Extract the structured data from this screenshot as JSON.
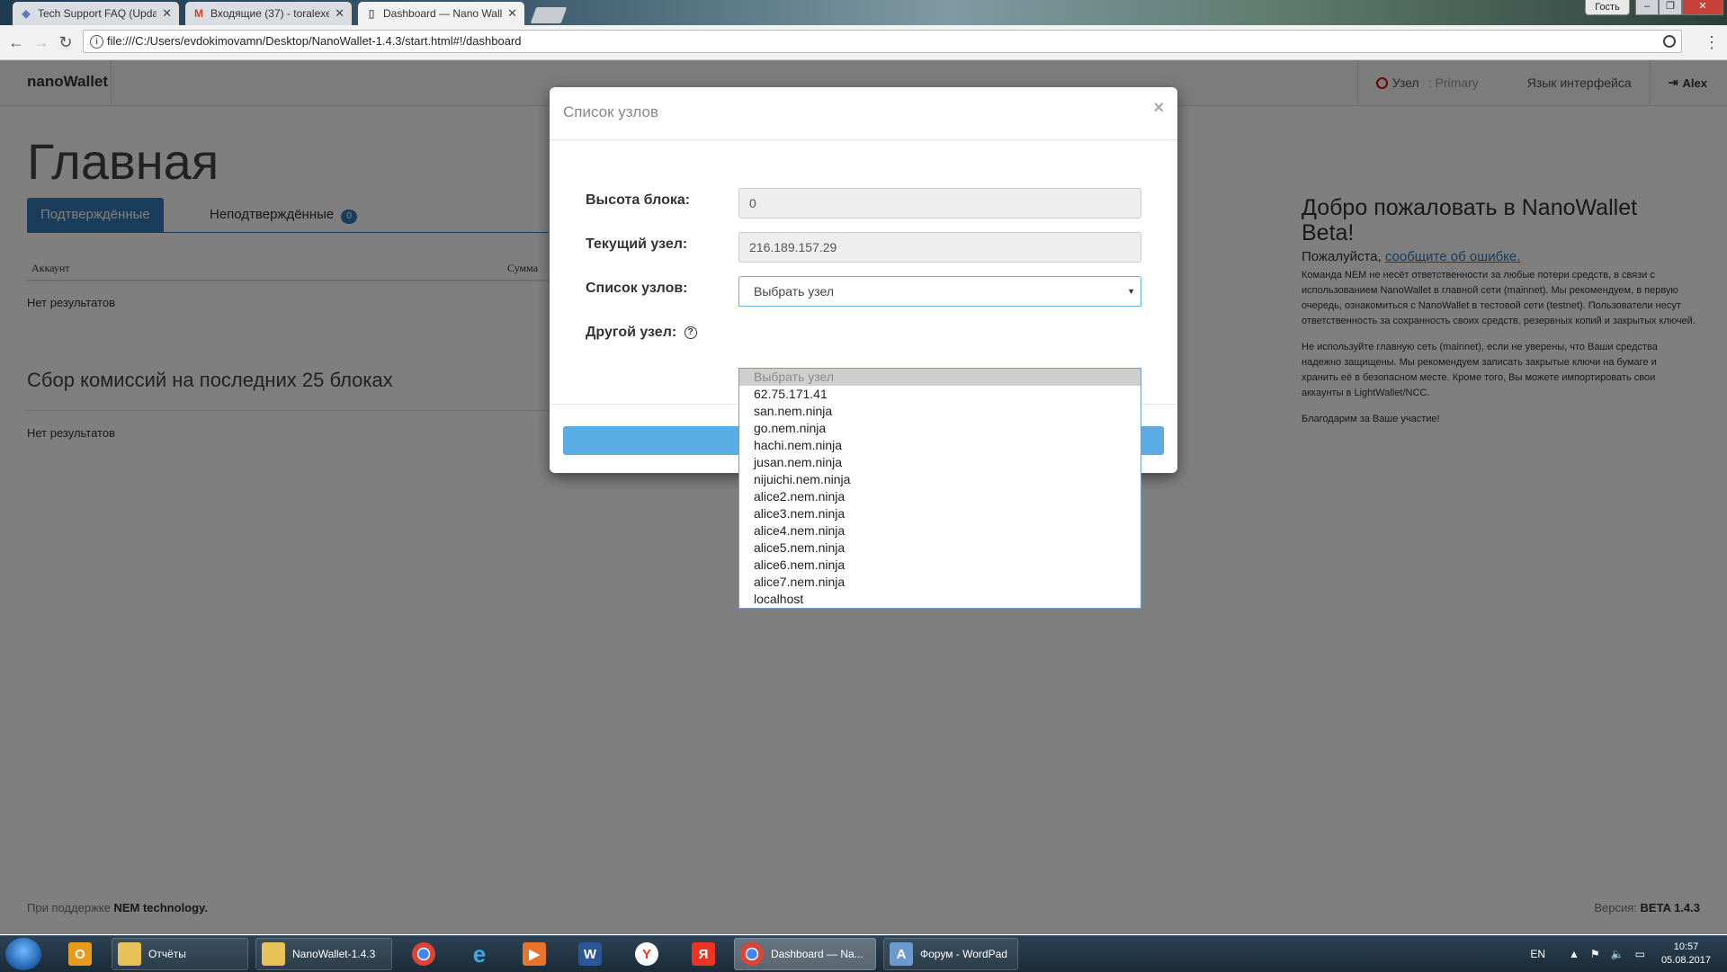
{
  "browser": {
    "tabs": [
      {
        "title": "Tech Support FAQ (Upda",
        "icon": "shield-icon"
      },
      {
        "title": "Входящие (37) - toralexe",
        "icon": "gmail-icon"
      },
      {
        "title": "Dashboard — Nano Wall",
        "icon": "page-icon"
      }
    ],
    "guest_label": "Гость",
    "url": "file:///C:/Users/evdokimovamn/Desktop/NanoWallet-1.4.3/start.html#!/dashboard"
  },
  "navbar": {
    "brand": "nanoWallet",
    "node_label": "Узел",
    "node_value": ": Primary",
    "language_label": "Язык интерфейса",
    "user": "Alex"
  },
  "dashboard": {
    "title": "Главная",
    "tab_confirmed": "Подтверждённые",
    "tab_unconfirmed": "Неподтверждённые",
    "unconfirmed_count": "0",
    "col_account": "Аккаунт",
    "col_amount": "Сумма",
    "no_results": "Нет результатов",
    "harvest_title": "Сбор комиссий на последних 25 блоках",
    "no_results_2": "Нет результатов"
  },
  "welcome": {
    "title": "Добро пожаловать в NanoWallet Beta!",
    "report_prefix": "Пожалуйста,",
    "report_link": "сообщите об ошибке.",
    "p1": "Команда NEM не несёт ответственности за любые потери средств, в связи с использованием NanoWallet в главной сети (mainnet). Мы рекомендуем, в первую очередь, ознакомиться с NanoWallet в тестовой сети (testnet). Пользователи несут ответственность за сохранность своих средств, резервных копий и закрытых ключей.",
    "p2": "Не используйте главную сеть (mainnet), если не уверены, что Ваши средства надежно защищены. Мы рекомендуем записать закрытые ключи на бумаге и хранить её в безопасном месте. Кроме того, Вы можете импортировать свои аккаунты в LightWallet/NCC.",
    "p3": "Благодарим за Ваше участие!"
  },
  "footer": {
    "left_prefix": "При поддержке",
    "left_bold": "NEM technology.",
    "right_prefix": "Версия:",
    "right_bold": "BETA 1.4.3"
  },
  "modal": {
    "title": "Список узлов",
    "close": "×",
    "block_height_label": "Высота блока:",
    "block_height_value": "0",
    "current_node_label": "Текущий узел:",
    "current_node_value": "216.189.157.29",
    "node_list_label": "Список узлов:",
    "node_list_selected": "Выбрать узел",
    "other_node_label": "Другой узел:",
    "options": [
      "Выбрать узел",
      "62.75.171.41",
      "san.nem.ninja",
      "go.nem.ninja",
      "hachi.nem.ninja",
      "jusan.nem.ninja",
      "nijuichi.nem.ninja",
      "alice2.nem.ninja",
      "alice3.nem.ninja",
      "alice4.nem.ninja",
      "alice5.nem.ninja",
      "alice6.nem.ninja",
      "alice7.nem.ninja",
      "localhost"
    ]
  },
  "taskbar": {
    "items": [
      {
        "label": "Отчёты",
        "icon": "folder-icon"
      },
      {
        "label": "NanoWallet-1.4.3",
        "icon": "folder-icon"
      },
      {
        "label": "Dashboard — Na...",
        "icon": "chrome-icon"
      },
      {
        "label": "Форум - WordPad",
        "icon": "wordpad-icon"
      }
    ],
    "lang": "EN",
    "time": "10:57",
    "date": "05.08.2017"
  },
  "colors": {
    "primary": "#337ab7",
    "modal_button": "#5aace4",
    "node_status": "#dd0000"
  }
}
